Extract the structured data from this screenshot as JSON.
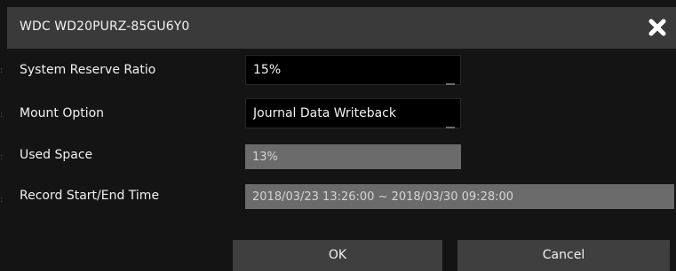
{
  "dialog": {
    "title": "WDC WD20PURZ-85GU6Y0",
    "close_icon": "close-icon"
  },
  "fields": {
    "system_reserve_ratio": {
      "label": "System Reserve Ratio",
      "value": "15%"
    },
    "mount_option": {
      "label": "Mount Option",
      "value": "Journal Data Writeback"
    },
    "used_space": {
      "label": "Used Space",
      "value": "13%"
    },
    "record_time": {
      "label": "Record Start/End Time",
      "value": "2018/03/23 13:26:00 ~ 2018/03/30 09:28:00"
    }
  },
  "buttons": {
    "ok": "OK",
    "cancel": "Cancel"
  },
  "colors": {
    "background": "#141414",
    "titlebar": "#3a3a3a",
    "readonly_field": "#6b6b6b",
    "button": "#3f3f3f"
  }
}
